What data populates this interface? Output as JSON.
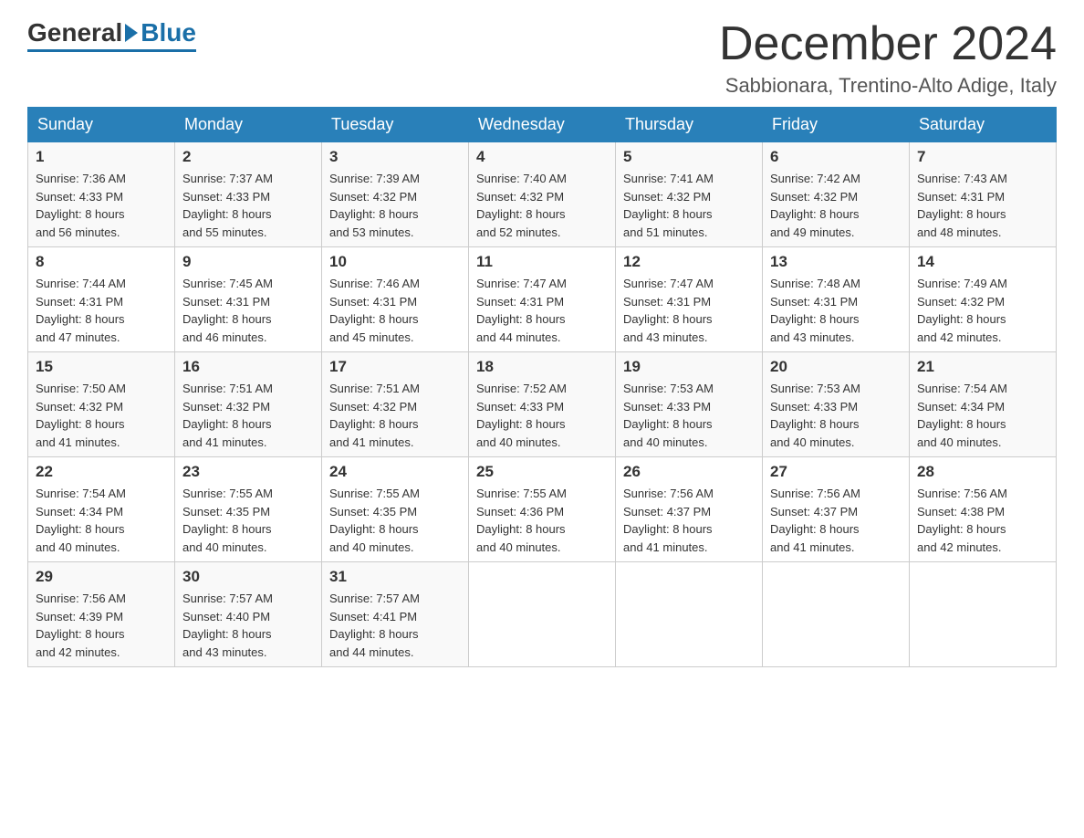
{
  "logo": {
    "general": "General",
    "blue": "Blue"
  },
  "title": "December 2024",
  "location": "Sabbionara, Trentino-Alto Adige, Italy",
  "days": [
    "Sunday",
    "Monday",
    "Tuesday",
    "Wednesday",
    "Thursday",
    "Friday",
    "Saturday"
  ],
  "weeks": [
    [
      {
        "day": "1",
        "sunrise": "7:36 AM",
        "sunset": "4:33 PM",
        "daylight": "8 hours and 56 minutes."
      },
      {
        "day": "2",
        "sunrise": "7:37 AM",
        "sunset": "4:33 PM",
        "daylight": "8 hours and 55 minutes."
      },
      {
        "day": "3",
        "sunrise": "7:39 AM",
        "sunset": "4:32 PM",
        "daylight": "8 hours and 53 minutes."
      },
      {
        "day": "4",
        "sunrise": "7:40 AM",
        "sunset": "4:32 PM",
        "daylight": "8 hours and 52 minutes."
      },
      {
        "day": "5",
        "sunrise": "7:41 AM",
        "sunset": "4:32 PM",
        "daylight": "8 hours and 51 minutes."
      },
      {
        "day": "6",
        "sunrise": "7:42 AM",
        "sunset": "4:32 PM",
        "daylight": "8 hours and 49 minutes."
      },
      {
        "day": "7",
        "sunrise": "7:43 AM",
        "sunset": "4:31 PM",
        "daylight": "8 hours and 48 minutes."
      }
    ],
    [
      {
        "day": "8",
        "sunrise": "7:44 AM",
        "sunset": "4:31 PM",
        "daylight": "8 hours and 47 minutes."
      },
      {
        "day": "9",
        "sunrise": "7:45 AM",
        "sunset": "4:31 PM",
        "daylight": "8 hours and 46 minutes."
      },
      {
        "day": "10",
        "sunrise": "7:46 AM",
        "sunset": "4:31 PM",
        "daylight": "8 hours and 45 minutes."
      },
      {
        "day": "11",
        "sunrise": "7:47 AM",
        "sunset": "4:31 PM",
        "daylight": "8 hours and 44 minutes."
      },
      {
        "day": "12",
        "sunrise": "7:47 AM",
        "sunset": "4:31 PM",
        "daylight": "8 hours and 43 minutes."
      },
      {
        "day": "13",
        "sunrise": "7:48 AM",
        "sunset": "4:31 PM",
        "daylight": "8 hours and 43 minutes."
      },
      {
        "day": "14",
        "sunrise": "7:49 AM",
        "sunset": "4:32 PM",
        "daylight": "8 hours and 42 minutes."
      }
    ],
    [
      {
        "day": "15",
        "sunrise": "7:50 AM",
        "sunset": "4:32 PM",
        "daylight": "8 hours and 41 minutes."
      },
      {
        "day": "16",
        "sunrise": "7:51 AM",
        "sunset": "4:32 PM",
        "daylight": "8 hours and 41 minutes."
      },
      {
        "day": "17",
        "sunrise": "7:51 AM",
        "sunset": "4:32 PM",
        "daylight": "8 hours and 41 minutes."
      },
      {
        "day": "18",
        "sunrise": "7:52 AM",
        "sunset": "4:33 PM",
        "daylight": "8 hours and 40 minutes."
      },
      {
        "day": "19",
        "sunrise": "7:53 AM",
        "sunset": "4:33 PM",
        "daylight": "8 hours and 40 minutes."
      },
      {
        "day": "20",
        "sunrise": "7:53 AM",
        "sunset": "4:33 PM",
        "daylight": "8 hours and 40 minutes."
      },
      {
        "day": "21",
        "sunrise": "7:54 AM",
        "sunset": "4:34 PM",
        "daylight": "8 hours and 40 minutes."
      }
    ],
    [
      {
        "day": "22",
        "sunrise": "7:54 AM",
        "sunset": "4:34 PM",
        "daylight": "8 hours and 40 minutes."
      },
      {
        "day": "23",
        "sunrise": "7:55 AM",
        "sunset": "4:35 PM",
        "daylight": "8 hours and 40 minutes."
      },
      {
        "day": "24",
        "sunrise": "7:55 AM",
        "sunset": "4:35 PM",
        "daylight": "8 hours and 40 minutes."
      },
      {
        "day": "25",
        "sunrise": "7:55 AM",
        "sunset": "4:36 PM",
        "daylight": "8 hours and 40 minutes."
      },
      {
        "day": "26",
        "sunrise": "7:56 AM",
        "sunset": "4:37 PM",
        "daylight": "8 hours and 41 minutes."
      },
      {
        "day": "27",
        "sunrise": "7:56 AM",
        "sunset": "4:37 PM",
        "daylight": "8 hours and 41 minutes."
      },
      {
        "day": "28",
        "sunrise": "7:56 AM",
        "sunset": "4:38 PM",
        "daylight": "8 hours and 42 minutes."
      }
    ],
    [
      {
        "day": "29",
        "sunrise": "7:56 AM",
        "sunset": "4:39 PM",
        "daylight": "8 hours and 42 minutes."
      },
      {
        "day": "30",
        "sunrise": "7:57 AM",
        "sunset": "4:40 PM",
        "daylight": "8 hours and 43 minutes."
      },
      {
        "day": "31",
        "sunrise": "7:57 AM",
        "sunset": "4:41 PM",
        "daylight": "8 hours and 44 minutes."
      },
      null,
      null,
      null,
      null
    ]
  ],
  "labels": {
    "sunrise": "Sunrise:",
    "sunset": "Sunset:",
    "daylight": "Daylight:"
  }
}
